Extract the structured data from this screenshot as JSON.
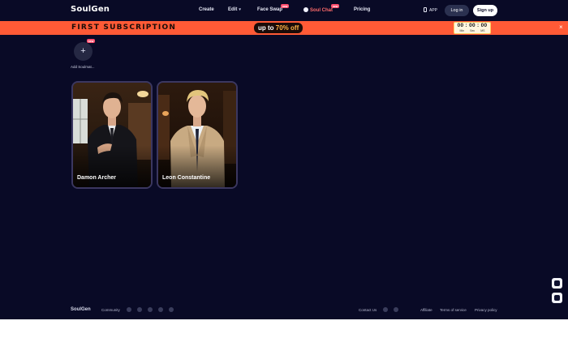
{
  "header": {
    "logo": "SoulGen",
    "nav": {
      "create": "Create",
      "edit": "Edit",
      "face_swap": "Face Swap",
      "soul_chat": "Soul Chat",
      "pricing": "Pricing"
    },
    "new_badge": "new",
    "app": "APP",
    "login": "Log in",
    "signup": "Sign up"
  },
  "promo": {
    "title": "FIRST SUBSCRIPTION",
    "offer_prefix": "up to ",
    "offer_value": "70% off",
    "timer": {
      "digits": "00 : 00 : 00",
      "min": "Min",
      "sec": "Sec",
      "ms": "MS"
    },
    "close": "×"
  },
  "add_soulmate": {
    "label": "Add Soulmat...",
    "plus": "+"
  },
  "cards": [
    {
      "name": "Damon Archer"
    },
    {
      "name": "Leon Constantine"
    }
  ],
  "footer": {
    "logo": "SoulGen",
    "community": "Community",
    "contact": "Contact Us",
    "affiliate": "Affiliate",
    "terms": "Terms of service",
    "privacy": "Privacy policy"
  },
  "colors": {
    "background": "#090a26",
    "promo": "#ff5a36",
    "accent_red": "#ff6b6b"
  }
}
